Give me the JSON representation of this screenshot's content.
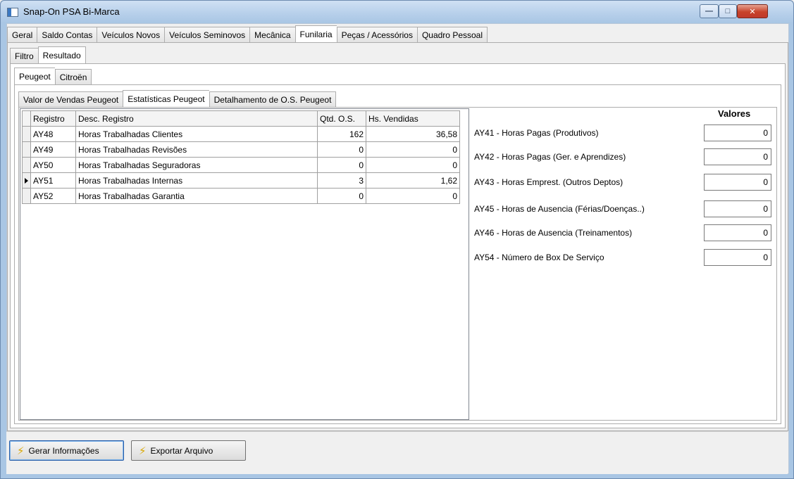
{
  "window": {
    "title": "Snap-On PSA Bi-Marca"
  },
  "main_tabs": [
    "Geral",
    "Saldo Contas",
    "Veículos Novos",
    "Veículos Seminovos",
    "Mecânica",
    "Funilaria",
    "Peças / Acessórios",
    "Quadro Pessoal"
  ],
  "main_tabs_active": "Funilaria",
  "sub_tabs": [
    "Filtro",
    "Resultado"
  ],
  "sub_tabs_active": "Resultado",
  "brand_tabs": [
    "Peugeot",
    "Citroën"
  ],
  "brand_tabs_active": "Peugeot",
  "report_tabs": [
    "Valor de Vendas Peugeot",
    "Estatísticas Peugeot",
    "Detalhamento de O.S. Peugeot"
  ],
  "report_tabs_active": "Estatísticas Peugeot",
  "grid": {
    "columns": [
      "Registro",
      "Desc. Registro",
      "Qtd. O.S.",
      "Hs. Vendidas"
    ],
    "rows": [
      {
        "registro": "AY48",
        "desc": "Horas Trabalhadas Clientes",
        "qtd": "162",
        "hs": "36,58"
      },
      {
        "registro": "AY49",
        "desc": "Horas Trabalhadas Revisões",
        "qtd": "0",
        "hs": "0"
      },
      {
        "registro": "AY50",
        "desc": "Horas Trabalhadas Seguradoras",
        "qtd": "0",
        "hs": "0"
      },
      {
        "registro": "AY51",
        "desc": "Horas Trabalhadas Internas",
        "qtd": "3",
        "hs": "1,62"
      },
      {
        "registro": "AY52",
        "desc": "Horas Trabalhadas Garantia",
        "qtd": "0",
        "hs": "0"
      }
    ],
    "current_row": 3
  },
  "valores": {
    "header": "Valores",
    "fields": [
      {
        "label": "AY41 - Horas Pagas (Produtivos)",
        "value": "0"
      },
      {
        "label": "AY42 - Horas Pagas (Ger. e Aprendizes)",
        "value": "0"
      },
      {
        "label": "AY43 - Horas Emprest. (Outros Deptos)",
        "value": "0"
      },
      {
        "label": "AY45 - Horas de Ausencia (Férias/Doenças..)",
        "value": "0"
      },
      {
        "label": "AY46 - Horas de Ausencia (Treinamentos)",
        "value": "0"
      },
      {
        "label": "AY54 - Número de Box De Serviço",
        "value": "0"
      }
    ]
  },
  "buttons": {
    "gerar": "Gerar Informações",
    "exportar": "Exportar Arquivo"
  },
  "icons": {
    "window": "app-icon",
    "buttons": "lightning-bolt-icon"
  }
}
